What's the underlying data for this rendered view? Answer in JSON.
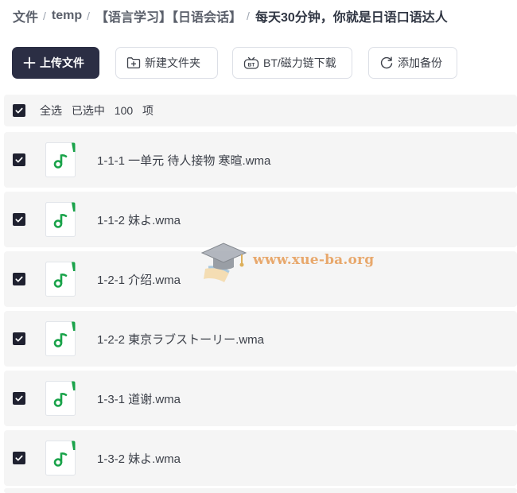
{
  "breadcrumb": {
    "items": [
      "文件",
      "temp",
      "【语言学习】【日语会话】",
      "每天30分钟，你就是日语口语达人"
    ],
    "separator": "/"
  },
  "toolbar": {
    "upload_label": "上传文件",
    "new_folder_label": "新建文件夹",
    "bt_label": "BT/磁力链下载",
    "backup_label": "添加备份"
  },
  "selection": {
    "select_all_label": "全选",
    "selected_text": "已选中",
    "count": "100",
    "unit": "项"
  },
  "files": [
    {
      "name": "1-1-1 一单元 待人接物 寒暄.wma",
      "checked": true
    },
    {
      "name": "1-1-2 妹よ.wma",
      "checked": true
    },
    {
      "name": "1-2-1 介绍.wma",
      "checked": true
    },
    {
      "name": "1-2-2 東京ラブストーリー.wma",
      "checked": true
    },
    {
      "name": "1-3-1 道谢.wma",
      "checked": true
    },
    {
      "name": "1-3-2 妹よ.wma",
      "checked": true
    }
  ],
  "watermark": {
    "text": "www.xue-ba.org"
  },
  "colors": {
    "primary_button": "#2b2e44",
    "music_icon": "#16a34a",
    "row_background": "#f5f5f5"
  }
}
